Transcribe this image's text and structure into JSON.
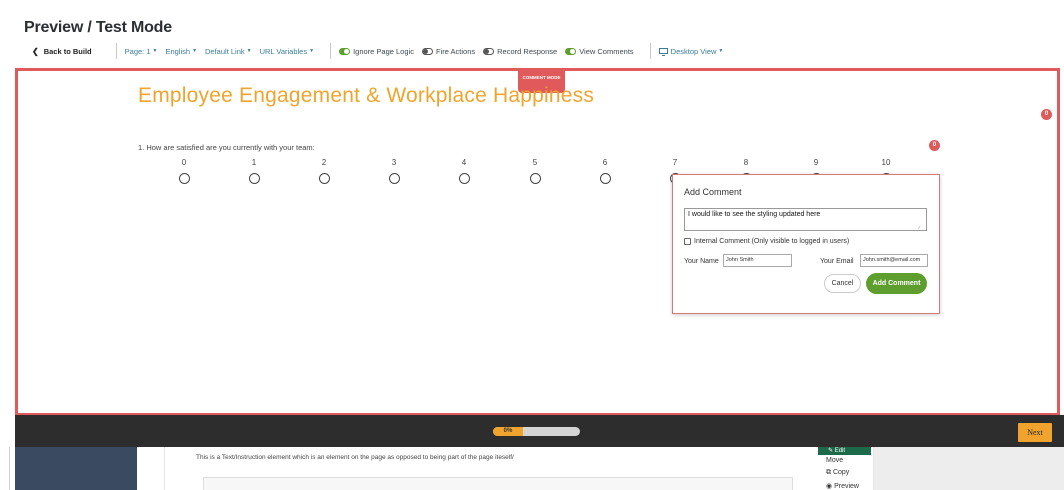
{
  "header": {
    "title": "Preview / Test Mode",
    "back_label": "Back to Build",
    "page_dropdown": "Page: 1",
    "language_dropdown": "English",
    "link_dropdown": "Default Link",
    "url_dropdown": "URL Variables",
    "toggles": [
      {
        "label": "Ignore Page Logic",
        "on": true
      },
      {
        "label": "Fire Actions",
        "on": false
      },
      {
        "label": "Record Response",
        "on": false
      },
      {
        "label": "View Comments",
        "on": true
      }
    ],
    "view_dropdown": "Desktop View"
  },
  "preview": {
    "mode_badge": "COMMENT MODE",
    "survey_title": "Employee Engagement & Workplace Happiness",
    "page_comment_count": "0",
    "question_comment_count": "0",
    "question": "1. How are satisfied are you currently with your team:",
    "scale": [
      "0",
      "1",
      "2",
      "3",
      "4",
      "5",
      "6",
      "7",
      "8",
      "9",
      "10"
    ]
  },
  "comment_popup": {
    "title": "Add Comment",
    "comment_text": "I would like to see the styling updated here",
    "internal_label": "Internal Comment (Only visible to logged in users)",
    "name_label": "Your Name",
    "name_value": "John Smith",
    "email_label": "Your Email",
    "email_value": "John.smith@email.com",
    "cancel_label": "Cancel",
    "add_label": "Add Comment"
  },
  "footer": {
    "progress_label": "0%",
    "progress_fraction": 0,
    "next_label": "Next"
  },
  "builder": {
    "text_element": "This is a Text/Instruction element which is an element on the page as opposed to being part of the page iteself/",
    "edit_label": "Edit",
    "move_label": "Move",
    "copy_label": "Copy",
    "preview_label": "Preview"
  },
  "colors": {
    "accent_red": "#e0595b",
    "accent_orange": "#f0a42d",
    "accent_green": "#5d9e2f",
    "link_blue": "#3a7d98"
  }
}
